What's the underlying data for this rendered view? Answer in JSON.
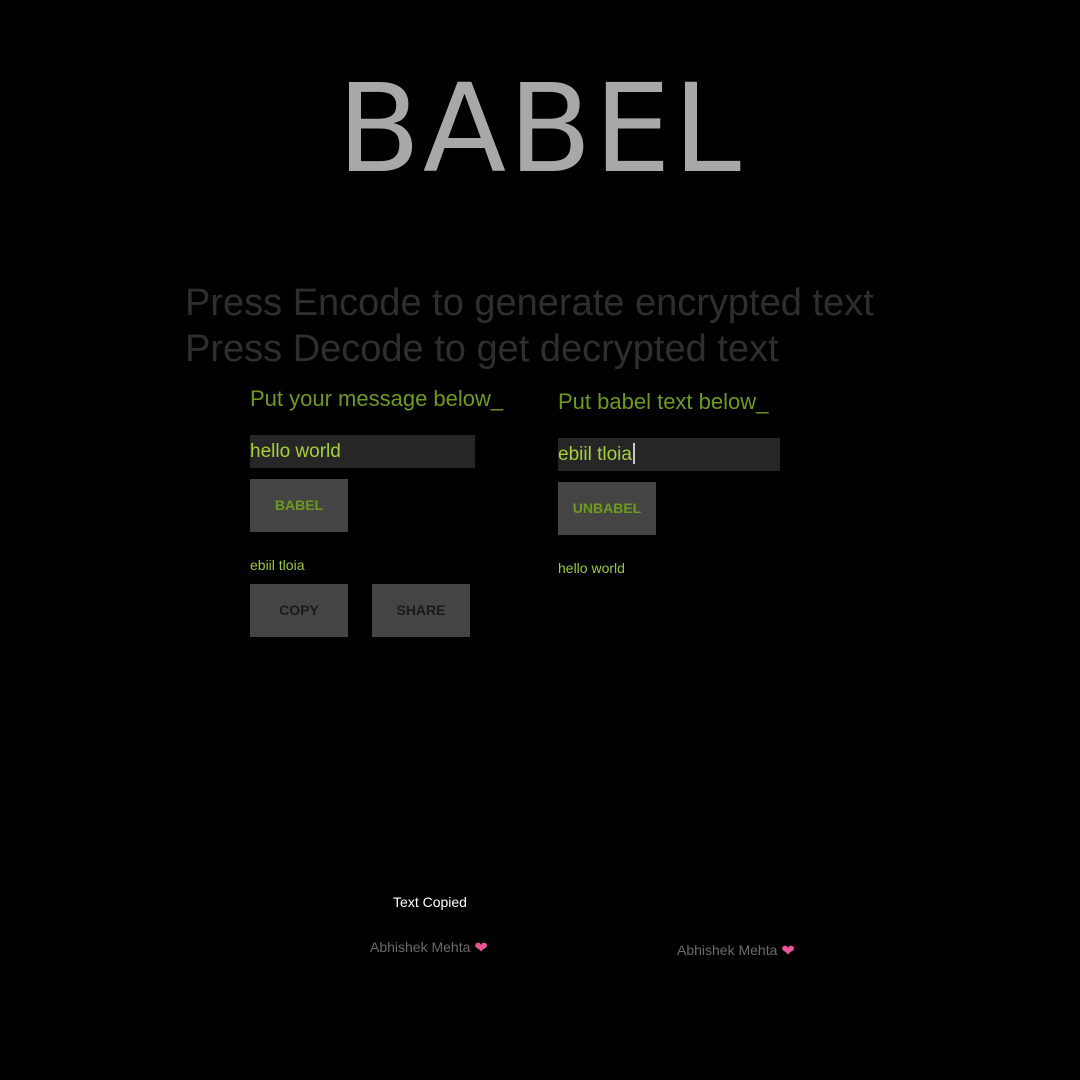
{
  "app": {
    "title": "BABEL"
  },
  "instructions": {
    "line1": "Press Encode to generate encrypted text",
    "line2": "Press Decode to get decrypted text"
  },
  "encode_panel": {
    "heading": "Put your message below_",
    "input_value": "hello world",
    "button_label": "BABEL",
    "result": "ebiil tloia",
    "copy_label": "COPY",
    "share_label": "SHARE"
  },
  "decode_panel": {
    "heading": "Put babel text below_",
    "input_value": "ebiil tloia",
    "button_label": "UNBABEL",
    "result": "hello world"
  },
  "toast": {
    "message": "Text Copied"
  },
  "credits": {
    "left": "Abhishek Mehta",
    "right": "Abhishek Mehta",
    "icon": "heart-icon"
  },
  "colors": {
    "background": "#000000",
    "accent_green": "#6e9a1e",
    "result_green": "#9cc83a",
    "title_gray": "#a8a8a8",
    "button_gray": "#444444",
    "heart_pink": "#e8559a"
  }
}
